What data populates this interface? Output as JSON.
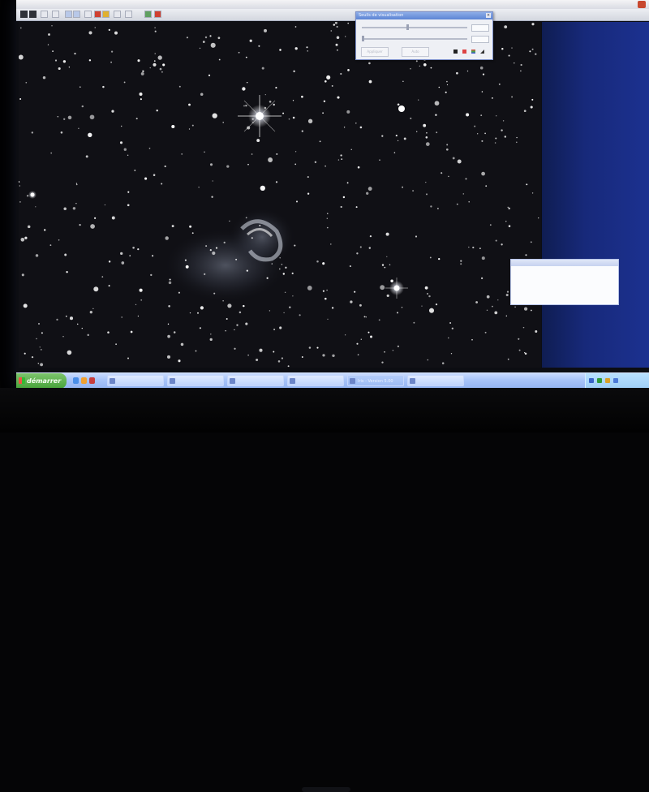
{
  "window": {
    "title": "",
    "background": "#0c0d12"
  },
  "toolbar": {
    "buttons": [
      {
        "icon": "open-icon"
      },
      {
        "icon": "save-icon"
      },
      {
        "icon": "select-icon"
      },
      {
        "icon": "zoom-in-icon"
      },
      {
        "icon": "zoom-out-icon"
      },
      {
        "icon": "grid-icon"
      },
      {
        "icon": "threshold-icon"
      },
      {
        "icon": "crop-icon"
      },
      {
        "icon": "color-icon"
      },
      {
        "icon": "stop-icon"
      }
    ]
  },
  "thresholds_dialog": {
    "title": "Seuils de visualisation",
    "close_glyph": "×",
    "high_slider_level": 0.42,
    "low_slider_level": 0.0,
    "buttons": [
      "Appliquer",
      "Auto"
    ]
  },
  "taskbar": {
    "start_label": "démarrer",
    "tasks": [
      "",
      "",
      "",
      "",
      "Iris - Version 5.00",
      ""
    ],
    "active_task_index": 4,
    "clock": ""
  },
  "colors": {
    "taskbar": "#a7c3f8",
    "start": "#47a33a",
    "desktop": "#1c3190",
    "dialog_header": "#5c84d4"
  }
}
